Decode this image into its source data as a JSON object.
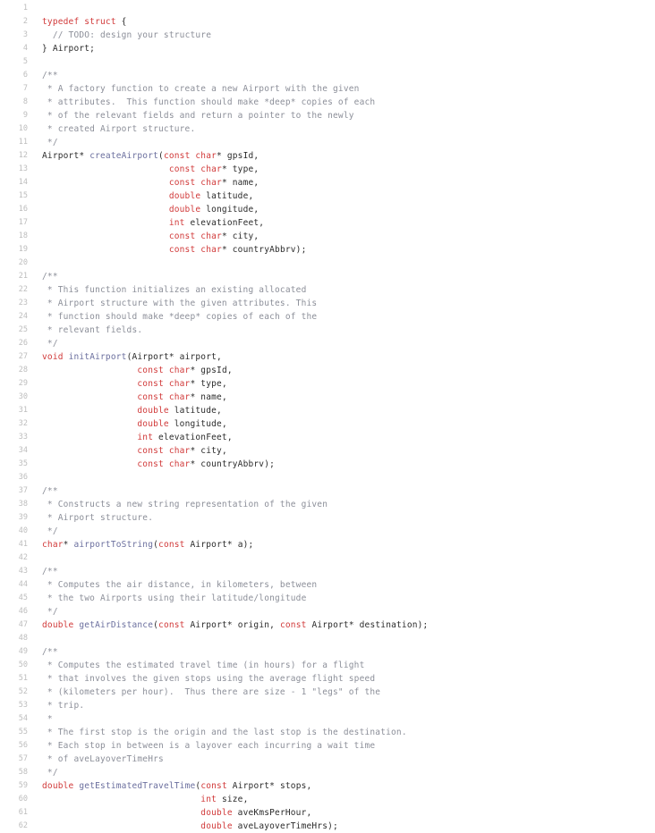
{
  "editor": {
    "language": "C",
    "background_color": "#ffffff",
    "gutter_color": "#bdbdbd",
    "colors": {
      "keyword": "#d13a3a",
      "type": "#d13a3a",
      "function": "#6b6f9e",
      "comment": "#8c8f99",
      "plain": "#2b2b2b"
    },
    "first_line_number": 1,
    "last_line_number": 62,
    "lines": [
      {
        "n": 1,
        "tokens": []
      },
      {
        "n": 2,
        "tokens": [
          {
            "t": "typedef struct",
            "c": "kw"
          },
          {
            "t": " {",
            "c": "punct"
          }
        ]
      },
      {
        "n": 3,
        "tokens": [
          {
            "t": "  ",
            "c": "plain"
          },
          {
            "t": "// TODO: design your structure",
            "c": "comment"
          }
        ]
      },
      {
        "n": 4,
        "tokens": [
          {
            "t": "} Airport;",
            "c": "plain"
          }
        ]
      },
      {
        "n": 5,
        "tokens": []
      },
      {
        "n": 6,
        "tokens": [
          {
            "t": "/**",
            "c": "comment"
          }
        ]
      },
      {
        "n": 7,
        "tokens": [
          {
            "t": " * A factory function to create a new Airport with the given",
            "c": "comment"
          }
        ]
      },
      {
        "n": 8,
        "tokens": [
          {
            "t": " * attributes.  This function should make *deep* copies of each",
            "c": "comment"
          }
        ]
      },
      {
        "n": 9,
        "tokens": [
          {
            "t": " * of the relevant fields and return a pointer to the newly",
            "c": "comment"
          }
        ]
      },
      {
        "n": 10,
        "tokens": [
          {
            "t": " * created Airport structure.",
            "c": "comment"
          }
        ]
      },
      {
        "n": 11,
        "tokens": [
          {
            "t": " */",
            "c": "comment"
          }
        ]
      },
      {
        "n": 12,
        "tokens": [
          {
            "t": "Airport* ",
            "c": "plain"
          },
          {
            "t": "createAirport",
            "c": "fn"
          },
          {
            "t": "(",
            "c": "punct"
          },
          {
            "t": "const char",
            "c": "type"
          },
          {
            "t": "* gpsId,",
            "c": "plain"
          }
        ]
      },
      {
        "n": 13,
        "tokens": [
          {
            "t": "                        ",
            "c": "plain"
          },
          {
            "t": "const char",
            "c": "type"
          },
          {
            "t": "* type,",
            "c": "plain"
          }
        ]
      },
      {
        "n": 14,
        "tokens": [
          {
            "t": "                        ",
            "c": "plain"
          },
          {
            "t": "const char",
            "c": "type"
          },
          {
            "t": "* name,",
            "c": "plain"
          }
        ]
      },
      {
        "n": 15,
        "tokens": [
          {
            "t": "                        ",
            "c": "plain"
          },
          {
            "t": "double",
            "c": "type"
          },
          {
            "t": " latitude,",
            "c": "plain"
          }
        ]
      },
      {
        "n": 16,
        "tokens": [
          {
            "t": "                        ",
            "c": "plain"
          },
          {
            "t": "double",
            "c": "type"
          },
          {
            "t": " longitude,",
            "c": "plain"
          }
        ]
      },
      {
        "n": 17,
        "tokens": [
          {
            "t": "                        ",
            "c": "plain"
          },
          {
            "t": "int",
            "c": "type"
          },
          {
            "t": " elevationFeet,",
            "c": "plain"
          }
        ]
      },
      {
        "n": 18,
        "tokens": [
          {
            "t": "                        ",
            "c": "plain"
          },
          {
            "t": "const char",
            "c": "type"
          },
          {
            "t": "* city,",
            "c": "plain"
          }
        ]
      },
      {
        "n": 19,
        "tokens": [
          {
            "t": "                        ",
            "c": "plain"
          },
          {
            "t": "const char",
            "c": "type"
          },
          {
            "t": "* countryAbbrv);",
            "c": "plain"
          }
        ]
      },
      {
        "n": 20,
        "tokens": []
      },
      {
        "n": 21,
        "tokens": [
          {
            "t": "/**",
            "c": "comment"
          }
        ]
      },
      {
        "n": 22,
        "tokens": [
          {
            "t": " * This function initializes an existing allocated",
            "c": "comment"
          }
        ]
      },
      {
        "n": 23,
        "tokens": [
          {
            "t": " * Airport structure with the given attributes. This",
            "c": "comment"
          }
        ]
      },
      {
        "n": 24,
        "tokens": [
          {
            "t": " * function should make *deep* copies of each of the",
            "c": "comment"
          }
        ]
      },
      {
        "n": 25,
        "tokens": [
          {
            "t": " * relevant fields.",
            "c": "comment"
          }
        ]
      },
      {
        "n": 26,
        "tokens": [
          {
            "t": " */",
            "c": "comment"
          }
        ]
      },
      {
        "n": 27,
        "tokens": [
          {
            "t": "void",
            "c": "kw"
          },
          {
            "t": " ",
            "c": "plain"
          },
          {
            "t": "initAirport",
            "c": "fn"
          },
          {
            "t": "(Airport* airport,",
            "c": "plain"
          }
        ]
      },
      {
        "n": 28,
        "tokens": [
          {
            "t": "                  ",
            "c": "plain"
          },
          {
            "t": "const char",
            "c": "type"
          },
          {
            "t": "* gpsId,",
            "c": "plain"
          }
        ]
      },
      {
        "n": 29,
        "tokens": [
          {
            "t": "                  ",
            "c": "plain"
          },
          {
            "t": "const char",
            "c": "type"
          },
          {
            "t": "* type,",
            "c": "plain"
          }
        ]
      },
      {
        "n": 30,
        "tokens": [
          {
            "t": "                  ",
            "c": "plain"
          },
          {
            "t": "const char",
            "c": "type"
          },
          {
            "t": "* name,",
            "c": "plain"
          }
        ]
      },
      {
        "n": 31,
        "tokens": [
          {
            "t": "                  ",
            "c": "plain"
          },
          {
            "t": "double",
            "c": "type"
          },
          {
            "t": " latitude,",
            "c": "plain"
          }
        ]
      },
      {
        "n": 32,
        "tokens": [
          {
            "t": "                  ",
            "c": "plain"
          },
          {
            "t": "double",
            "c": "type"
          },
          {
            "t": " longitude,",
            "c": "plain"
          }
        ]
      },
      {
        "n": 33,
        "tokens": [
          {
            "t": "                  ",
            "c": "plain"
          },
          {
            "t": "int",
            "c": "type"
          },
          {
            "t": " elevationFeet,",
            "c": "plain"
          }
        ]
      },
      {
        "n": 34,
        "tokens": [
          {
            "t": "                  ",
            "c": "plain"
          },
          {
            "t": "const char",
            "c": "type"
          },
          {
            "t": "* city,",
            "c": "plain"
          }
        ]
      },
      {
        "n": 35,
        "tokens": [
          {
            "t": "                  ",
            "c": "plain"
          },
          {
            "t": "const char",
            "c": "type"
          },
          {
            "t": "* countryAbbrv);",
            "c": "plain"
          }
        ]
      },
      {
        "n": 36,
        "tokens": []
      },
      {
        "n": 37,
        "tokens": [
          {
            "t": "/**",
            "c": "comment"
          }
        ]
      },
      {
        "n": 38,
        "tokens": [
          {
            "t": " * Constructs a new string representation of the given",
            "c": "comment"
          }
        ]
      },
      {
        "n": 39,
        "tokens": [
          {
            "t": " * Airport structure.",
            "c": "comment"
          }
        ]
      },
      {
        "n": 40,
        "tokens": [
          {
            "t": " */",
            "c": "comment"
          }
        ]
      },
      {
        "n": 41,
        "tokens": [
          {
            "t": "char",
            "c": "type"
          },
          {
            "t": "* ",
            "c": "plain"
          },
          {
            "t": "airportToString",
            "c": "fn"
          },
          {
            "t": "(",
            "c": "punct"
          },
          {
            "t": "const",
            "c": "type"
          },
          {
            "t": " Airport* a);",
            "c": "plain"
          }
        ]
      },
      {
        "n": 42,
        "tokens": []
      },
      {
        "n": 43,
        "tokens": [
          {
            "t": "/**",
            "c": "comment"
          }
        ]
      },
      {
        "n": 44,
        "tokens": [
          {
            "t": " * Computes the air distance, in kilometers, between",
            "c": "comment"
          }
        ]
      },
      {
        "n": 45,
        "tokens": [
          {
            "t": " * the two Airports using their latitude/longitude",
            "c": "comment"
          }
        ]
      },
      {
        "n": 46,
        "tokens": [
          {
            "t": " */",
            "c": "comment"
          }
        ]
      },
      {
        "n": 47,
        "tokens": [
          {
            "t": "double",
            "c": "type"
          },
          {
            "t": " ",
            "c": "plain"
          },
          {
            "t": "getAirDistance",
            "c": "fn"
          },
          {
            "t": "(",
            "c": "punct"
          },
          {
            "t": "const",
            "c": "type"
          },
          {
            "t": " Airport* origin, ",
            "c": "plain"
          },
          {
            "t": "const",
            "c": "type"
          },
          {
            "t": " Airport* destination);",
            "c": "plain"
          }
        ]
      },
      {
        "n": 48,
        "tokens": []
      },
      {
        "n": 49,
        "tokens": [
          {
            "t": "/**",
            "c": "comment"
          }
        ]
      },
      {
        "n": 50,
        "tokens": [
          {
            "t": " * Computes the estimated travel time (in hours) for a flight",
            "c": "comment"
          }
        ]
      },
      {
        "n": 51,
        "tokens": [
          {
            "t": " * that involves the given stops using the average flight speed",
            "c": "comment"
          }
        ]
      },
      {
        "n": 52,
        "tokens": [
          {
            "t": " * (kilometers per hour).  Thus there are size - 1 \"legs\" of the",
            "c": "comment"
          }
        ]
      },
      {
        "n": 53,
        "tokens": [
          {
            "t": " * trip.",
            "c": "comment"
          }
        ]
      },
      {
        "n": 54,
        "tokens": [
          {
            "t": " *",
            "c": "comment"
          }
        ]
      },
      {
        "n": 55,
        "tokens": [
          {
            "t": " * The first stop is the origin and the last stop is the destination.",
            "c": "comment"
          }
        ]
      },
      {
        "n": 56,
        "tokens": [
          {
            "t": " * Each stop in between is a layover each incurring a wait time",
            "c": "comment"
          }
        ]
      },
      {
        "n": 57,
        "tokens": [
          {
            "t": " * of aveLayoverTimeHrs",
            "c": "comment"
          }
        ]
      },
      {
        "n": 58,
        "tokens": [
          {
            "t": " */",
            "c": "comment"
          }
        ]
      },
      {
        "n": 59,
        "tokens": [
          {
            "t": "double",
            "c": "type"
          },
          {
            "t": " ",
            "c": "plain"
          },
          {
            "t": "getEstimatedTravelTime",
            "c": "fn"
          },
          {
            "t": "(",
            "c": "punct"
          },
          {
            "t": "const",
            "c": "type"
          },
          {
            "t": " Airport* stops,",
            "c": "plain"
          }
        ]
      },
      {
        "n": 60,
        "tokens": [
          {
            "t": "                              ",
            "c": "plain"
          },
          {
            "t": "int",
            "c": "type"
          },
          {
            "t": " size,",
            "c": "plain"
          }
        ]
      },
      {
        "n": 61,
        "tokens": [
          {
            "t": "                              ",
            "c": "plain"
          },
          {
            "t": "double",
            "c": "type"
          },
          {
            "t": " aveKmsPerHour,",
            "c": "plain"
          }
        ]
      },
      {
        "n": 62,
        "tokens": [
          {
            "t": "                              ",
            "c": "plain"
          },
          {
            "t": "double",
            "c": "type"
          },
          {
            "t": " aveLayoverTimeHrs);",
            "c": "plain"
          }
        ]
      }
    ]
  }
}
